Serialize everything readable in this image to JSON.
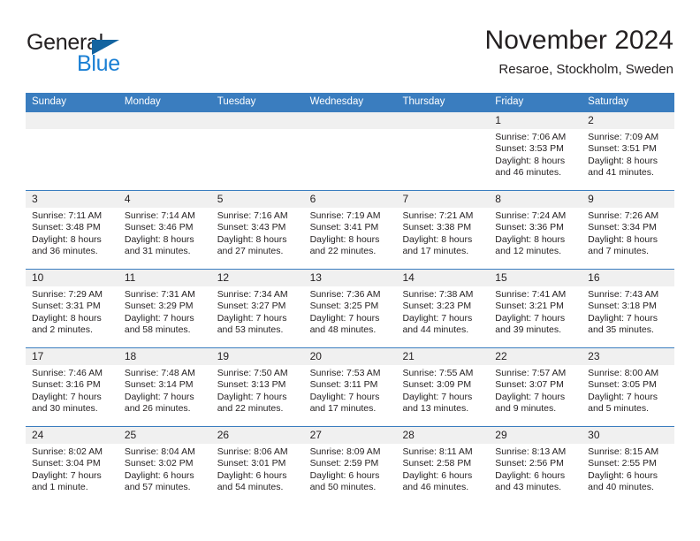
{
  "logo": {
    "word_one": "General",
    "word_two": "Blue",
    "triangle_color": "#1464a0",
    "blue_color": "#1a7fd4"
  },
  "header": {
    "title": "November 2024",
    "subtitle": "Resaroe, Stockholm, Sweden"
  },
  "theme": {
    "header_bar": "#3a7dbf",
    "date_band": "#f0f0f0",
    "text": "#231f20"
  },
  "calendar": {
    "weekdays": [
      "Sunday",
      "Monday",
      "Tuesday",
      "Wednesday",
      "Thursday",
      "Friday",
      "Saturday"
    ],
    "weeks": [
      [
        {
          "day": "",
          "sunrise": "",
          "sunset": "",
          "daylight_line1": "",
          "daylight_line2": ""
        },
        {
          "day": "",
          "sunrise": "",
          "sunset": "",
          "daylight_line1": "",
          "daylight_line2": ""
        },
        {
          "day": "",
          "sunrise": "",
          "sunset": "",
          "daylight_line1": "",
          "daylight_line2": ""
        },
        {
          "day": "",
          "sunrise": "",
          "sunset": "",
          "daylight_line1": "",
          "daylight_line2": ""
        },
        {
          "day": "",
          "sunrise": "",
          "sunset": "",
          "daylight_line1": "",
          "daylight_line2": ""
        },
        {
          "day": "1",
          "sunrise": "Sunrise: 7:06 AM",
          "sunset": "Sunset: 3:53 PM",
          "daylight_line1": "Daylight: 8 hours",
          "daylight_line2": "and 46 minutes."
        },
        {
          "day": "2",
          "sunrise": "Sunrise: 7:09 AM",
          "sunset": "Sunset: 3:51 PM",
          "daylight_line1": "Daylight: 8 hours",
          "daylight_line2": "and 41 minutes."
        }
      ],
      [
        {
          "day": "3",
          "sunrise": "Sunrise: 7:11 AM",
          "sunset": "Sunset: 3:48 PM",
          "daylight_line1": "Daylight: 8 hours",
          "daylight_line2": "and 36 minutes."
        },
        {
          "day": "4",
          "sunrise": "Sunrise: 7:14 AM",
          "sunset": "Sunset: 3:46 PM",
          "daylight_line1": "Daylight: 8 hours",
          "daylight_line2": "and 31 minutes."
        },
        {
          "day": "5",
          "sunrise": "Sunrise: 7:16 AM",
          "sunset": "Sunset: 3:43 PM",
          "daylight_line1": "Daylight: 8 hours",
          "daylight_line2": "and 27 minutes."
        },
        {
          "day": "6",
          "sunrise": "Sunrise: 7:19 AM",
          "sunset": "Sunset: 3:41 PM",
          "daylight_line1": "Daylight: 8 hours",
          "daylight_line2": "and 22 minutes."
        },
        {
          "day": "7",
          "sunrise": "Sunrise: 7:21 AM",
          "sunset": "Sunset: 3:38 PM",
          "daylight_line1": "Daylight: 8 hours",
          "daylight_line2": "and 17 minutes."
        },
        {
          "day": "8",
          "sunrise": "Sunrise: 7:24 AM",
          "sunset": "Sunset: 3:36 PM",
          "daylight_line1": "Daylight: 8 hours",
          "daylight_line2": "and 12 minutes."
        },
        {
          "day": "9",
          "sunrise": "Sunrise: 7:26 AM",
          "sunset": "Sunset: 3:34 PM",
          "daylight_line1": "Daylight: 8 hours",
          "daylight_line2": "and 7 minutes."
        }
      ],
      [
        {
          "day": "10",
          "sunrise": "Sunrise: 7:29 AM",
          "sunset": "Sunset: 3:31 PM",
          "daylight_line1": "Daylight: 8 hours",
          "daylight_line2": "and 2 minutes."
        },
        {
          "day": "11",
          "sunrise": "Sunrise: 7:31 AM",
          "sunset": "Sunset: 3:29 PM",
          "daylight_line1": "Daylight: 7 hours",
          "daylight_line2": "and 58 minutes."
        },
        {
          "day": "12",
          "sunrise": "Sunrise: 7:34 AM",
          "sunset": "Sunset: 3:27 PM",
          "daylight_line1": "Daylight: 7 hours",
          "daylight_line2": "and 53 minutes."
        },
        {
          "day": "13",
          "sunrise": "Sunrise: 7:36 AM",
          "sunset": "Sunset: 3:25 PM",
          "daylight_line1": "Daylight: 7 hours",
          "daylight_line2": "and 48 minutes."
        },
        {
          "day": "14",
          "sunrise": "Sunrise: 7:38 AM",
          "sunset": "Sunset: 3:23 PM",
          "daylight_line1": "Daylight: 7 hours",
          "daylight_line2": "and 44 minutes."
        },
        {
          "day": "15",
          "sunrise": "Sunrise: 7:41 AM",
          "sunset": "Sunset: 3:21 PM",
          "daylight_line1": "Daylight: 7 hours",
          "daylight_line2": "and 39 minutes."
        },
        {
          "day": "16",
          "sunrise": "Sunrise: 7:43 AM",
          "sunset": "Sunset: 3:18 PM",
          "daylight_line1": "Daylight: 7 hours",
          "daylight_line2": "and 35 minutes."
        }
      ],
      [
        {
          "day": "17",
          "sunrise": "Sunrise: 7:46 AM",
          "sunset": "Sunset: 3:16 PM",
          "daylight_line1": "Daylight: 7 hours",
          "daylight_line2": "and 30 minutes."
        },
        {
          "day": "18",
          "sunrise": "Sunrise: 7:48 AM",
          "sunset": "Sunset: 3:14 PM",
          "daylight_line1": "Daylight: 7 hours",
          "daylight_line2": "and 26 minutes."
        },
        {
          "day": "19",
          "sunrise": "Sunrise: 7:50 AM",
          "sunset": "Sunset: 3:13 PM",
          "daylight_line1": "Daylight: 7 hours",
          "daylight_line2": "and 22 minutes."
        },
        {
          "day": "20",
          "sunrise": "Sunrise: 7:53 AM",
          "sunset": "Sunset: 3:11 PM",
          "daylight_line1": "Daylight: 7 hours",
          "daylight_line2": "and 17 minutes."
        },
        {
          "day": "21",
          "sunrise": "Sunrise: 7:55 AM",
          "sunset": "Sunset: 3:09 PM",
          "daylight_line1": "Daylight: 7 hours",
          "daylight_line2": "and 13 minutes."
        },
        {
          "day": "22",
          "sunrise": "Sunrise: 7:57 AM",
          "sunset": "Sunset: 3:07 PM",
          "daylight_line1": "Daylight: 7 hours",
          "daylight_line2": "and 9 minutes."
        },
        {
          "day": "23",
          "sunrise": "Sunrise: 8:00 AM",
          "sunset": "Sunset: 3:05 PM",
          "daylight_line1": "Daylight: 7 hours",
          "daylight_line2": "and 5 minutes."
        }
      ],
      [
        {
          "day": "24",
          "sunrise": "Sunrise: 8:02 AM",
          "sunset": "Sunset: 3:04 PM",
          "daylight_line1": "Daylight: 7 hours",
          "daylight_line2": "and 1 minute."
        },
        {
          "day": "25",
          "sunrise": "Sunrise: 8:04 AM",
          "sunset": "Sunset: 3:02 PM",
          "daylight_line1": "Daylight: 6 hours",
          "daylight_line2": "and 57 minutes."
        },
        {
          "day": "26",
          "sunrise": "Sunrise: 8:06 AM",
          "sunset": "Sunset: 3:01 PM",
          "daylight_line1": "Daylight: 6 hours",
          "daylight_line2": "and 54 minutes."
        },
        {
          "day": "27",
          "sunrise": "Sunrise: 8:09 AM",
          "sunset": "Sunset: 2:59 PM",
          "daylight_line1": "Daylight: 6 hours",
          "daylight_line2": "and 50 minutes."
        },
        {
          "day": "28",
          "sunrise": "Sunrise: 8:11 AM",
          "sunset": "Sunset: 2:58 PM",
          "daylight_line1": "Daylight: 6 hours",
          "daylight_line2": "and 46 minutes."
        },
        {
          "day": "29",
          "sunrise": "Sunrise: 8:13 AM",
          "sunset": "Sunset: 2:56 PM",
          "daylight_line1": "Daylight: 6 hours",
          "daylight_line2": "and 43 minutes."
        },
        {
          "day": "30",
          "sunrise": "Sunrise: 8:15 AM",
          "sunset": "Sunset: 2:55 PM",
          "daylight_line1": "Daylight: 6 hours",
          "daylight_line2": "and 40 minutes."
        }
      ]
    ]
  }
}
